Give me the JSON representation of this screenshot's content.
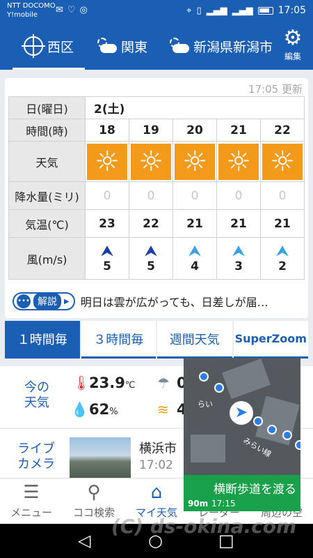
{
  "status_bar": {
    "carrier": "NTT DOCOMO",
    "carrier2": "Y!mobile",
    "time": "17:05"
  },
  "locations": {
    "tabs": [
      {
        "label": "西区",
        "icon": "location-crosshair-icon"
      },
      {
        "label": "関東",
        "icon": "partly-cloudy-icon"
      },
      {
        "label": "新潟県新潟市",
        "icon": "partly-cloudy-icon"
      }
    ],
    "edit_label": "編集"
  },
  "forecast": {
    "updated": "17:05 更新",
    "labels": {
      "date": "日(曜日)",
      "time": "時間(時)",
      "weather": "天気",
      "rain": "降水量(ミリ)",
      "temp": "気温(℃)",
      "wind": "風(m/s)"
    },
    "date": "2(土)",
    "hours": [
      {
        "time": "18",
        "weather": "sunny",
        "rain": "0",
        "temp": "23",
        "wind": "5",
        "wind_shade": "dark"
      },
      {
        "time": "19",
        "weather": "sunny",
        "rain": "0",
        "temp": "22",
        "wind": "5",
        "wind_shade": "dark"
      },
      {
        "time": "20",
        "weather": "sunny",
        "rain": "0",
        "temp": "21",
        "wind": "4",
        "wind_shade": "light"
      },
      {
        "time": "21",
        "weather": "sunny",
        "rain": "0",
        "temp": "21",
        "wind": "3",
        "wind_shade": "light"
      },
      {
        "time": "22",
        "weather": "sunny",
        "rain": "0",
        "temp": "21",
        "wind": "2",
        "wind_shade": "light"
      }
    ],
    "comment_badge": "解説",
    "comment": "明日は雲が広がっても、日差しが届…"
  },
  "view_tabs": [
    "１時間毎",
    "３時間毎",
    "週間天気",
    "SuperZoom"
  ],
  "current": {
    "label": "今の\n天気",
    "temp": "23.9",
    "temp_unit": "℃",
    "humidity": "62",
    "humidity_unit": "%",
    "rain_partial": "0",
    "wind_partial": "4"
  },
  "camera": {
    "label": "ライブ\nカメラ",
    "place": "横浜市",
    "time": "17:02"
  },
  "bottom_nav": [
    {
      "label": "メニュー",
      "icon": "menu-icon"
    },
    {
      "label": "ココ検索",
      "icon": "search-icon"
    },
    {
      "label": "マイ天気",
      "icon": "home-icon"
    },
    {
      "label": "レーダー",
      "icon": "radar-icon"
    },
    {
      "label": "周辺の空",
      "icon": "sky-icon"
    }
  ],
  "map_overlay": {
    "instruction": "横断歩道を渡る",
    "distance": "90m",
    "eta": "17:15",
    "street1": "らい",
    "street2": "みらい線"
  },
  "watermark": "(C) ds-okina.com",
  "colors": {
    "primary": "#1a5fb4",
    "sunny": "#f39a1a",
    "nav_green": "#19a04a"
  }
}
